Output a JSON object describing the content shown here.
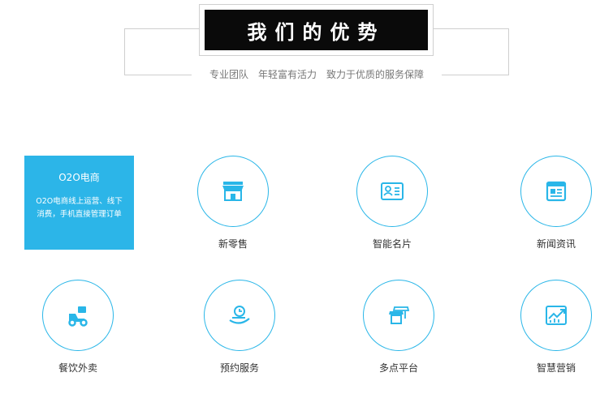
{
  "header": {
    "title": "我们的优势",
    "subtitle": "专业团队　年轻富有活力　致力于优质的服务保障"
  },
  "feature_card": {
    "title": "O2O电商",
    "description": "O2O电商线上运营、线下消费，手机直接管理订单"
  },
  "items": [
    {
      "label": "新零售",
      "icon": "storefront-icon"
    },
    {
      "label": "智能名片",
      "icon": "business-card-icon"
    },
    {
      "label": "新闻资讯",
      "icon": "newspaper-icon"
    },
    {
      "label": "餐饮外卖",
      "icon": "delivery-scooter-icon"
    },
    {
      "label": "预约服务",
      "icon": "appointment-clock-icon"
    },
    {
      "label": "多点平台",
      "icon": "multi-store-icon"
    },
    {
      "label": "智慧营销",
      "icon": "growth-chart-icon"
    }
  ],
  "colors": {
    "accent": "#29b6e8",
    "card_bg": "#2cb5e8",
    "title_bg": "#0a0a0a"
  }
}
